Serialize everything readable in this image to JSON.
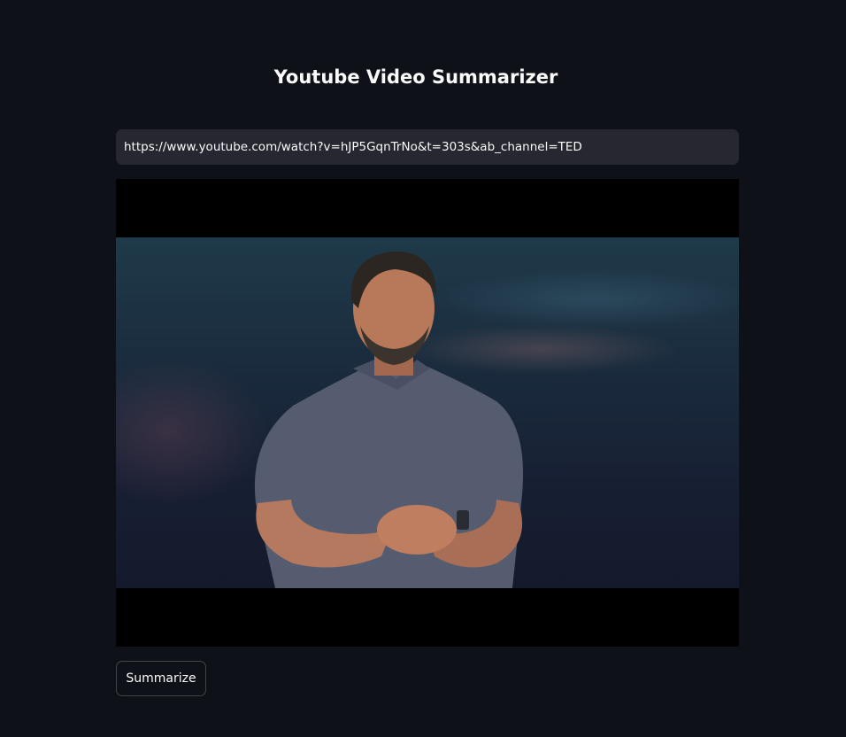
{
  "page": {
    "title": "Youtube Video Summarizer"
  },
  "url_input": {
    "value": "https://www.youtube.com/watch?v=hJP5GqnTrNo&t=303s&ab_channel=TED",
    "placeholder": ""
  },
  "video": {
    "content": "speaker-on-stage-thumbnail"
  },
  "actions": {
    "summarize_label": "Summarize"
  },
  "colors": {
    "background": "#0e1117",
    "input_background": "#262730",
    "text": "#fafafa"
  }
}
